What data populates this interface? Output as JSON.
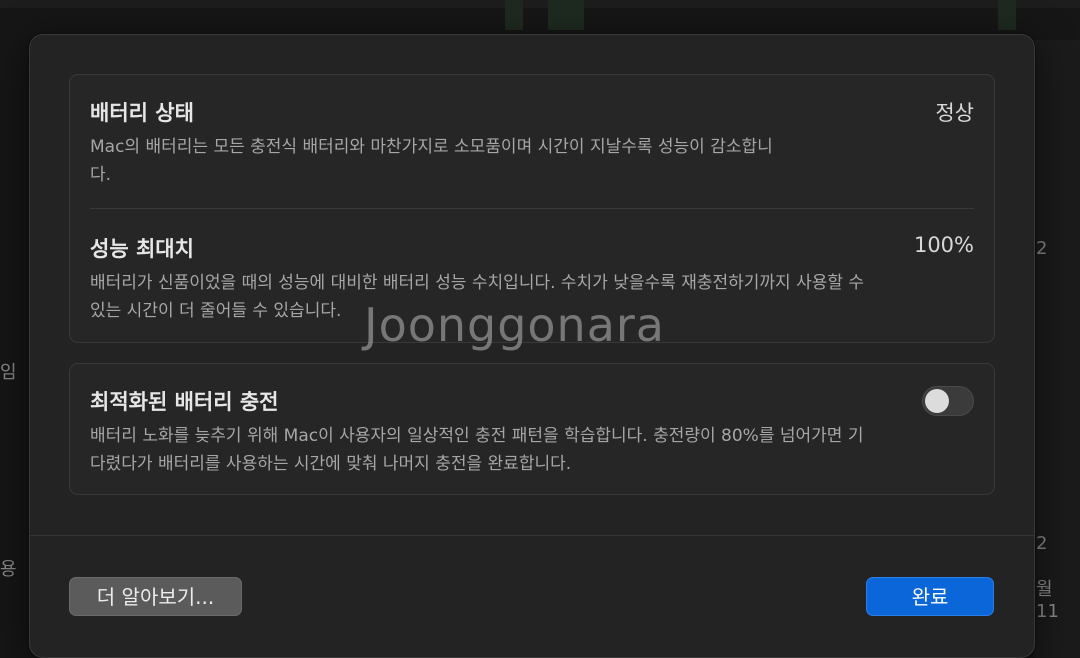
{
  "sections": {
    "battery_condition": {
      "title": "배터리 상태",
      "value": "정상",
      "description": "Mac의 배터리는 모든 충전식 배터리와 마찬가지로 소모품이며 시간이 지날수록 성능이 감소합니다."
    },
    "maximum_capacity": {
      "title": "성능 최대치",
      "value": "100%",
      "description": "배터리가 신품이었을 때의 성능에 대비한 배터리 성능 수치입니다. 수치가 낮을수록 재충전하기까지 사용할 수 있는 시간이 더 줄어들 수 있습니다."
    },
    "optimized_charging": {
      "title": "최적화된 배터리 충전",
      "enabled": false,
      "description": "배터리 노화를 늦추기 위해 Mac이 사용자의 일상적인 충전 패턴을 학습합니다. 충전량이 80%를 넘어가면 기다렸다가 배터리를 사용하는 시간에 맞춰 나머지 충전을 완료합니다."
    }
  },
  "buttons": {
    "learn_more": "더 알아보기...",
    "done": "완료"
  },
  "watermark": "Joonggonara",
  "background": {
    "left_text_1": "임",
    "left_text_2": "용",
    "right_text_1": "2",
    "right_text_2": "2",
    "right_text_3": "월 11"
  },
  "colors": {
    "accent": "#0a66d9",
    "dialog_bg": "#232323",
    "card_bg": "#262626"
  }
}
